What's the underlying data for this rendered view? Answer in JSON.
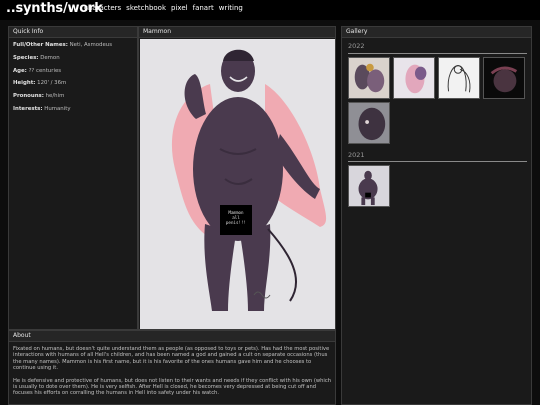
{
  "site": {
    "title": "..synths/work",
    "nav": [
      "characters",
      "sketchbook",
      "pixel",
      "fanart",
      "writing"
    ]
  },
  "quick_info": {
    "heading": "Quick Info",
    "rows": [
      {
        "label": "Full/Other Names:",
        "value": "Neti, Asmodeus"
      },
      {
        "label": "Species:",
        "value": "Demon"
      },
      {
        "label": "Age:",
        "value": "?? centuries"
      },
      {
        "label": "Height:",
        "value": "120' / 36m"
      },
      {
        "label": "Pronouns:",
        "value": "he/him"
      },
      {
        "label": "Interests:",
        "value": "Humanity"
      }
    ]
  },
  "portrait": {
    "heading": "Mammon",
    "censor_text": "Mammon\nall\npenis!!!"
  },
  "about": {
    "heading": "About",
    "paragraphs": [
      "Fixated on humans, but doesn't quite understand them as people (as opposed to toys or pets). Has had the most positive interactions with humans of all Hell's children, and has been named a god and gained a cult on separate occasions (thus the many names). Mammon is his first name, but it is his favorite of the ones humans gave him and he chooses to continue using it.",
      "He is defensive and protective of humans, but does not listen to their wants and needs if they conflict with his own (which is usually to dote over them). He is very selfish. After Hell is closed, he becomes very depressed at being cut off and focuses his efforts on corralling the humans in Hell into safety under his watch."
    ]
  },
  "gallery": {
    "heading": "Gallery",
    "years": [
      {
        "year": "2022",
        "thumbs": [
          "sketch-purple-figures",
          "sketch-pink-figures",
          "sketch-lineart",
          "sketch-dark-figure",
          "sketch-face-closeup"
        ]
      },
      {
        "year": "2021",
        "thumbs": [
          "sketch-standing-figure"
        ]
      }
    ]
  },
  "colors": {
    "skin": "#4a3a4e",
    "cape": "#f2a0a8",
    "background": "#0d0d0d",
    "panel": "#1a1a1a"
  }
}
